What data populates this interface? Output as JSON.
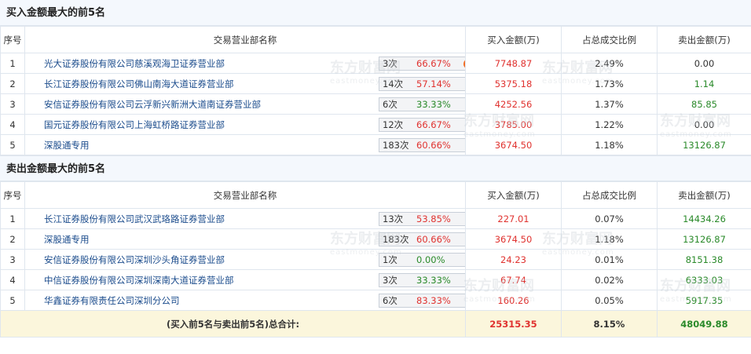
{
  "buy_section": {
    "title": "买入金额最大的前5名",
    "headers": {
      "idx": "序号",
      "name": "交易营业部名称",
      "buy": "买入金额(万)",
      "pct": "占总成交比例",
      "sell": "卖出金额(万)"
    },
    "rows": [
      {
        "idx": "1",
        "name": "光大证券股份有限公司慈溪观海卫证券营业部",
        "count": "3次",
        "rate": "66.67%",
        "rate_color": "red",
        "icon": "question-icon",
        "buy": "7748.87",
        "pct": "2.49%",
        "sell": "0.00",
        "sell_neutral": true
      },
      {
        "idx": "2",
        "name": "长江证券股份有限公司佛山南海大道证券营业部",
        "count": "14次",
        "rate": "57.14%",
        "rate_color": "red",
        "icon": "arrow-icon",
        "buy": "5375.18",
        "pct": "1.73%",
        "sell": "1.14",
        "sell_neutral": false
      },
      {
        "idx": "3",
        "name": "安信证券股份有限公司云浮新兴新洲大道南证券营业部",
        "count": "6次",
        "rate": "33.33%",
        "rate_color": "green",
        "icon": "arrow-icon",
        "buy": "4252.56",
        "pct": "1.37%",
        "sell": "85.85",
        "sell_neutral": false
      },
      {
        "idx": "4",
        "name": "国元证券股份有限公司上海虹桥路证券营业部",
        "count": "12次",
        "rate": "66.67%",
        "rate_color": "red",
        "icon": "arrow-icon",
        "buy": "3785.00",
        "pct": "1.22%",
        "sell": "0.00",
        "sell_neutral": true
      },
      {
        "idx": "5",
        "name": "深股通专用",
        "count": "183次",
        "rate": "60.66%",
        "rate_color": "red",
        "icon": "arrow-icon",
        "buy": "3674.50",
        "pct": "1.18%",
        "sell": "13126.87",
        "sell_neutral": false
      }
    ]
  },
  "sell_section": {
    "title": "卖出金额最大的前5名",
    "headers": {
      "idx": "序号",
      "name": "交易营业部名称",
      "buy": "买入金额(万)",
      "pct": "占总成交比例",
      "sell": "卖出金额(万)"
    },
    "rows": [
      {
        "idx": "1",
        "name": "长江证券股份有限公司武汉武珞路证券营业部",
        "count": "13次",
        "rate": "53.85%",
        "rate_color": "red",
        "icon": "arrow-icon",
        "buy": "227.01",
        "pct": "0.07%",
        "sell": "14434.26"
      },
      {
        "idx": "2",
        "name": "深股通专用",
        "count": "183次",
        "rate": "60.66%",
        "rate_color": "red",
        "icon": "arrow-icon",
        "buy": "3674.50",
        "pct": "1.18%",
        "sell": "13126.87"
      },
      {
        "idx": "3",
        "name": "安信证券股份有限公司深圳沙头角证券营业部",
        "count": "1次",
        "rate": "0.00%",
        "rate_color": "green",
        "icon": "arrow-icon",
        "buy": "24.23",
        "pct": "0.01%",
        "sell": "8151.38"
      },
      {
        "idx": "4",
        "name": "中信证券股份有限公司深圳深南大道证券营业部",
        "count": "3次",
        "rate": "33.33%",
        "rate_color": "green",
        "icon": "arrow-icon",
        "buy": "67.74",
        "pct": "0.02%",
        "sell": "6333.03"
      },
      {
        "idx": "5",
        "name": "华鑫证券有限责任公司深圳分公司",
        "count": "6次",
        "rate": "83.33%",
        "rate_color": "red",
        "icon": "arrow-icon",
        "buy": "160.26",
        "pct": "0.05%",
        "sell": "5917.35"
      }
    ],
    "total": {
      "label": "(买入前5名与卖出前5名)总合计:",
      "buy": "25315.35",
      "pct": "8.15%",
      "sell": "48049.88"
    }
  },
  "watermark": {
    "cn": "东方财富网",
    "en": "eastmoney.com"
  },
  "colors": {
    "buy": "#e0322f",
    "sell": "#2a8a2a",
    "link": "#1a4b8c",
    "total_bg": "#fbf6dc",
    "header_bg": "#f4f8fd"
  }
}
